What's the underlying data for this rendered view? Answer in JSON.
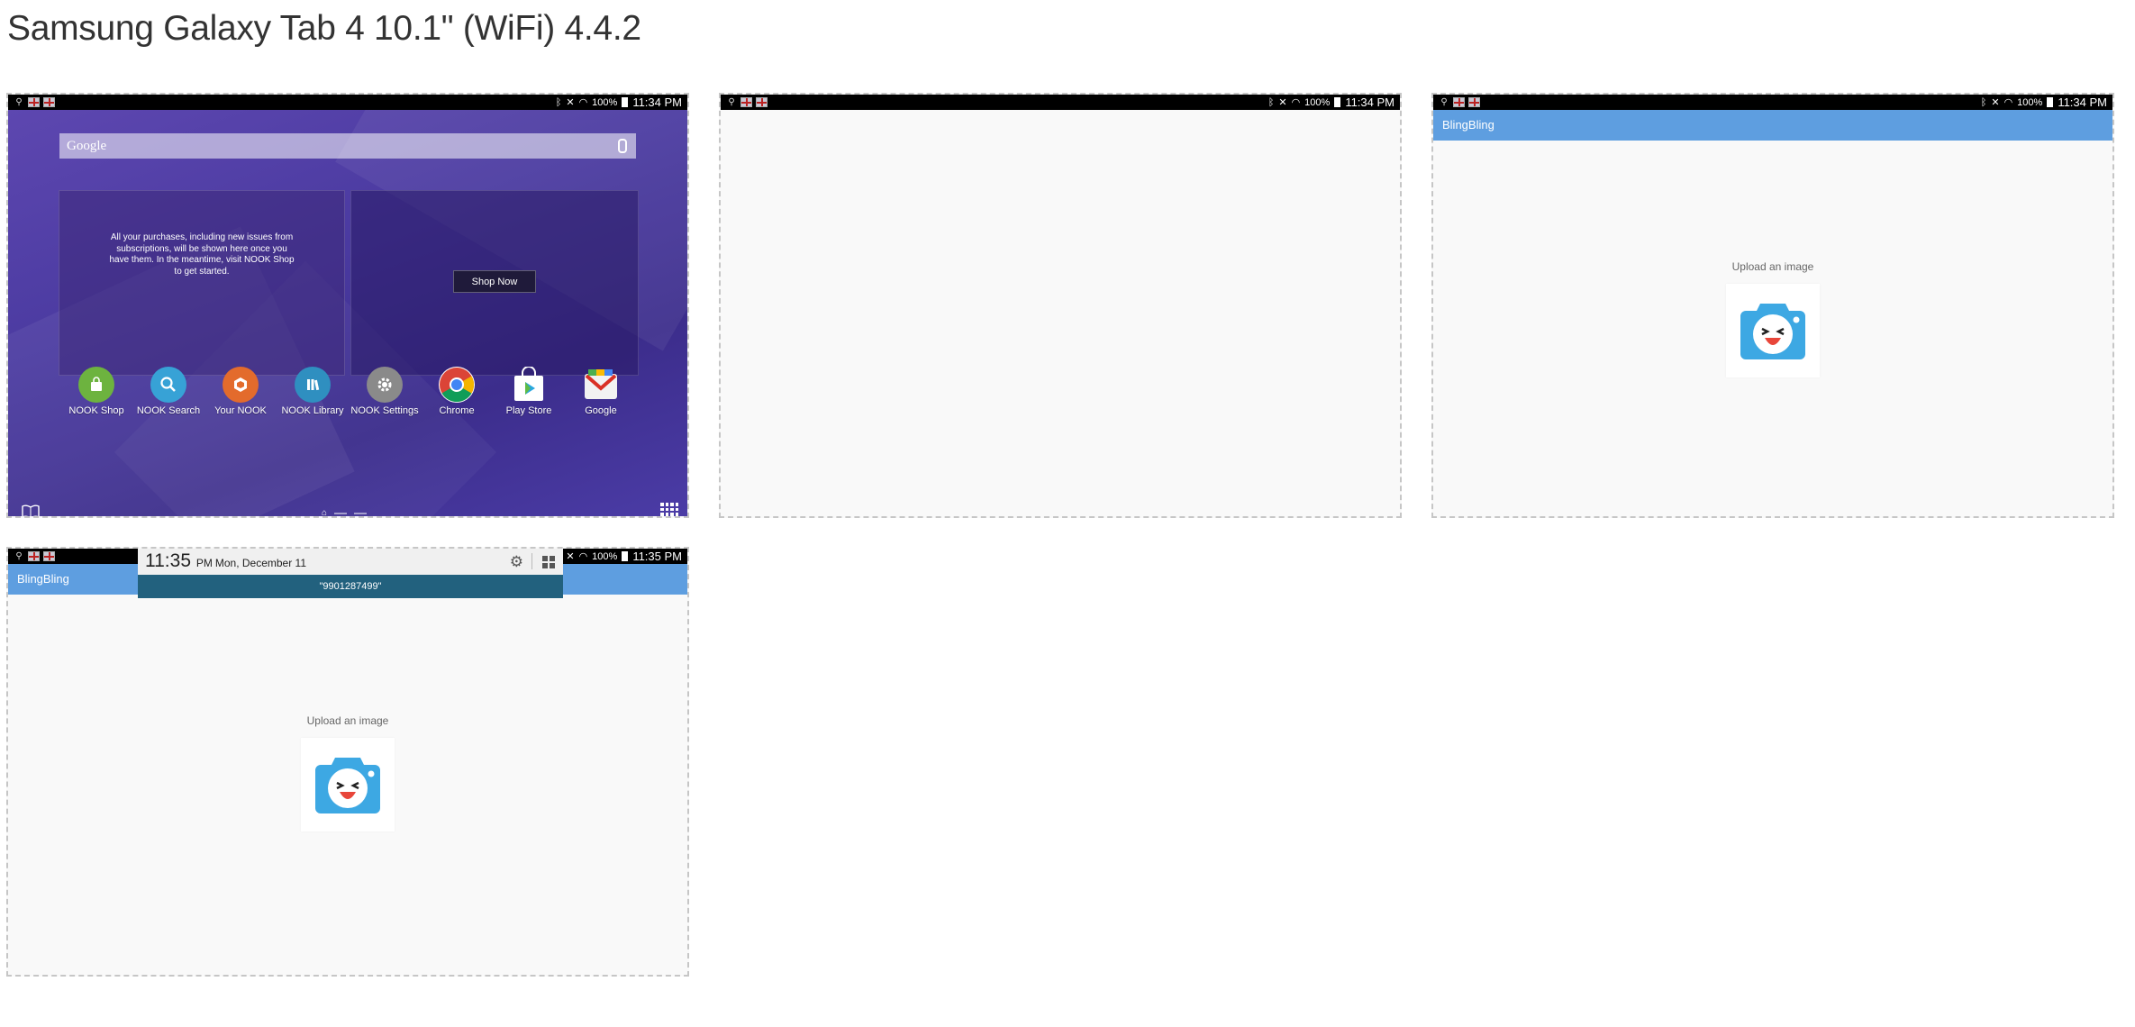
{
  "page": {
    "title": "Samsung Galaxy Tab 4 10.1\" (WiFi) 4.4.2"
  },
  "statusbar": {
    "battery": "100%",
    "time_shot1": "11:34 PM",
    "time_shot2": "11:34 PM",
    "time_shot3": "11:34 PM",
    "time_shot4": "11:35 PM"
  },
  "home": {
    "search_placeholder": "Google",
    "widget_text": "All your purchases, including new issues from subscriptions, will be shown here once you have them. In the meantime, visit NOOK Shop to get started.",
    "shop_now": "Shop Now",
    "apps": [
      {
        "label": "NOOK Shop",
        "icon": "shopping-bag-icon",
        "color": "#6db33f"
      },
      {
        "label": "NOOK Search",
        "icon": "search-icon",
        "color": "#37a2d6"
      },
      {
        "label": "Your NOOK",
        "icon": "nook-icon",
        "color": "#e36b2c"
      },
      {
        "label": "NOOK Library",
        "icon": "library-icon",
        "color": "#2f8fc0"
      },
      {
        "label": "NOOK Settings",
        "icon": "gear-icon",
        "color": "#8a8a8a"
      },
      {
        "label": "Chrome",
        "icon": "chrome-icon",
        "color": "#ffffff"
      },
      {
        "label": "Play Store",
        "icon": "play-store-icon",
        "color": "#ffffff"
      },
      {
        "label": "Google",
        "icon": "gmail-icon",
        "color": "#ffffff"
      }
    ]
  },
  "app": {
    "title": "BlingBling",
    "upload_text": "Upload an image",
    "accent": "#5e9ee0",
    "camera_color": "#3da8e3"
  },
  "notification": {
    "time": "11:35",
    "ampm": "PM",
    "date": "Mon, December 11",
    "message": "\"9901287499\""
  }
}
